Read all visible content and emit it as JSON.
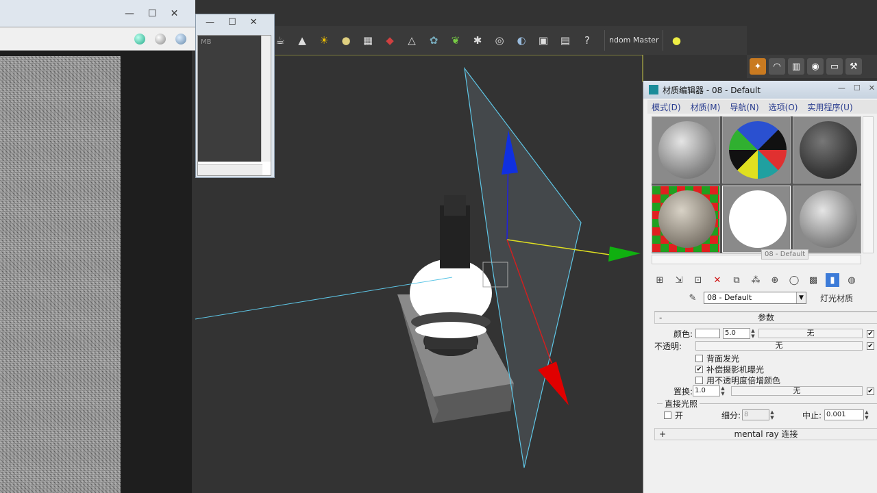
{
  "toolbar": {
    "render_master_label": "ndom Master",
    "icons": [
      "teapot-icon",
      "cone-icon",
      "sun-icon",
      "sphere-icon",
      "grid-icon",
      "capsule-icon",
      "pyramid-icon",
      "geosphere-icon",
      "plant-icon",
      "hair-icon",
      "ox-icon",
      "render-icon",
      "particle-icon",
      "display-icon",
      "help-icon"
    ]
  },
  "small_dialog": {
    "list_text": "MB"
  },
  "material_editor": {
    "title": "材质编辑器 - 08 - Default",
    "menu": [
      "模式(D)",
      "材质(M)",
      "导航(N)",
      "选项(O)",
      "实用程序(U)"
    ],
    "tooltip": "08 - Default",
    "material_name": "08 - Default",
    "material_type": "灯光材质",
    "params": {
      "rollout_title": "参数",
      "rollout_toggle": "-",
      "color_label": "颜色:",
      "color_value": "#ffffff",
      "color_amount": "5.0",
      "color_map": "无",
      "opacity_label": "不透明:",
      "opacity_map": "无",
      "check_backface": "背面发光",
      "check_compensate": "补偿摄影机曝光",
      "check_multiply": "用不透明度倍增颜色",
      "displace_label": "置换:",
      "displace_value": "1.0",
      "displace_map": "无",
      "direct_light_group": "直接光照",
      "on_label": "开",
      "subdivs_label": "细分:",
      "subdivs_value": "8",
      "cutoff_label": "中止:",
      "cutoff_value": "0.001"
    },
    "mentalray_rollout": "mental ray 连接",
    "mentalray_toggle": "+"
  }
}
